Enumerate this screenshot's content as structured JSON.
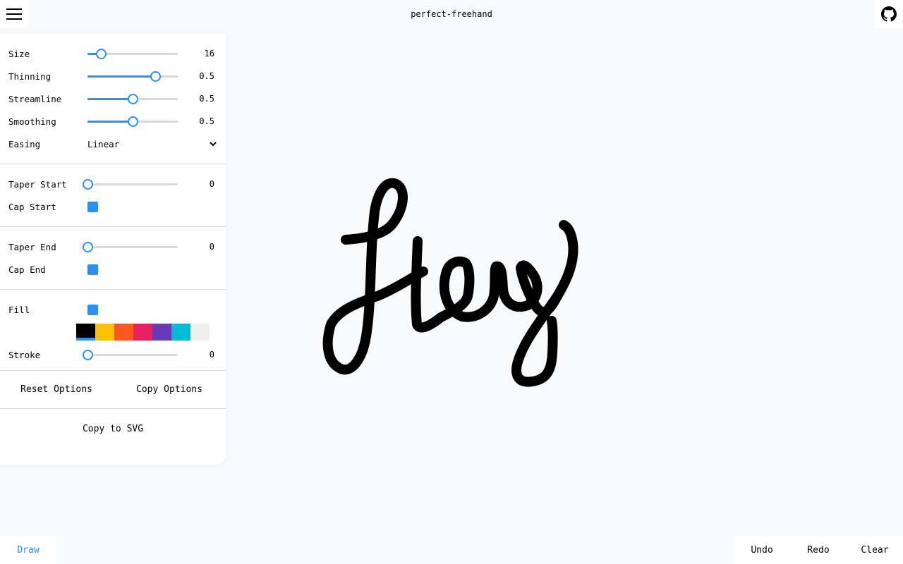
{
  "header": {
    "title": "perfect-freehand"
  },
  "icons": {
    "menu": "hamburger-menu-icon",
    "github": "github-icon",
    "chevron": "chevron-down-icon"
  },
  "options": {
    "size": {
      "label": "Size",
      "value": "16",
      "fraction": 0.15
    },
    "thinning": {
      "label": "Thinning",
      "value": "0.5",
      "fraction": 0.75
    },
    "streamline": {
      "label": "Streamline",
      "value": "0.5",
      "fraction": 0.5
    },
    "smoothing": {
      "label": "Smoothing",
      "value": "0.5",
      "fraction": 0.5
    },
    "easing": {
      "label": "Easing",
      "value": "Linear"
    },
    "taper_start": {
      "label": "Taper Start",
      "value": "0",
      "fraction": 0
    },
    "cap_start": {
      "label": "Cap Start",
      "checked": true
    },
    "taper_end": {
      "label": "Taper End",
      "value": "0",
      "fraction": 0
    },
    "cap_end": {
      "label": "Cap End",
      "checked": true
    },
    "fill": {
      "label": "Fill",
      "checked": true
    },
    "colors": [
      "#000000",
      "#ffc107",
      "#ff5722",
      "#e91e63",
      "#673ab7",
      "#00bcd4",
      "#efefef"
    ],
    "selected_color": "#000000",
    "stroke": {
      "label": "Stroke",
      "value": "0",
      "fraction": 0
    }
  },
  "buttons": {
    "reset": "Reset Options",
    "copy_options": "Copy Options",
    "copy_svg": "Copy to SVG"
  },
  "toolbar": {
    "draw": "Draw"
  },
  "actions": {
    "undo": "Undo",
    "redo": "Redo",
    "clear": "Clear"
  },
  "theme": {
    "accent": "#2d8ff2",
    "background": "#f8f9fb",
    "stroke_color": "#000000"
  }
}
